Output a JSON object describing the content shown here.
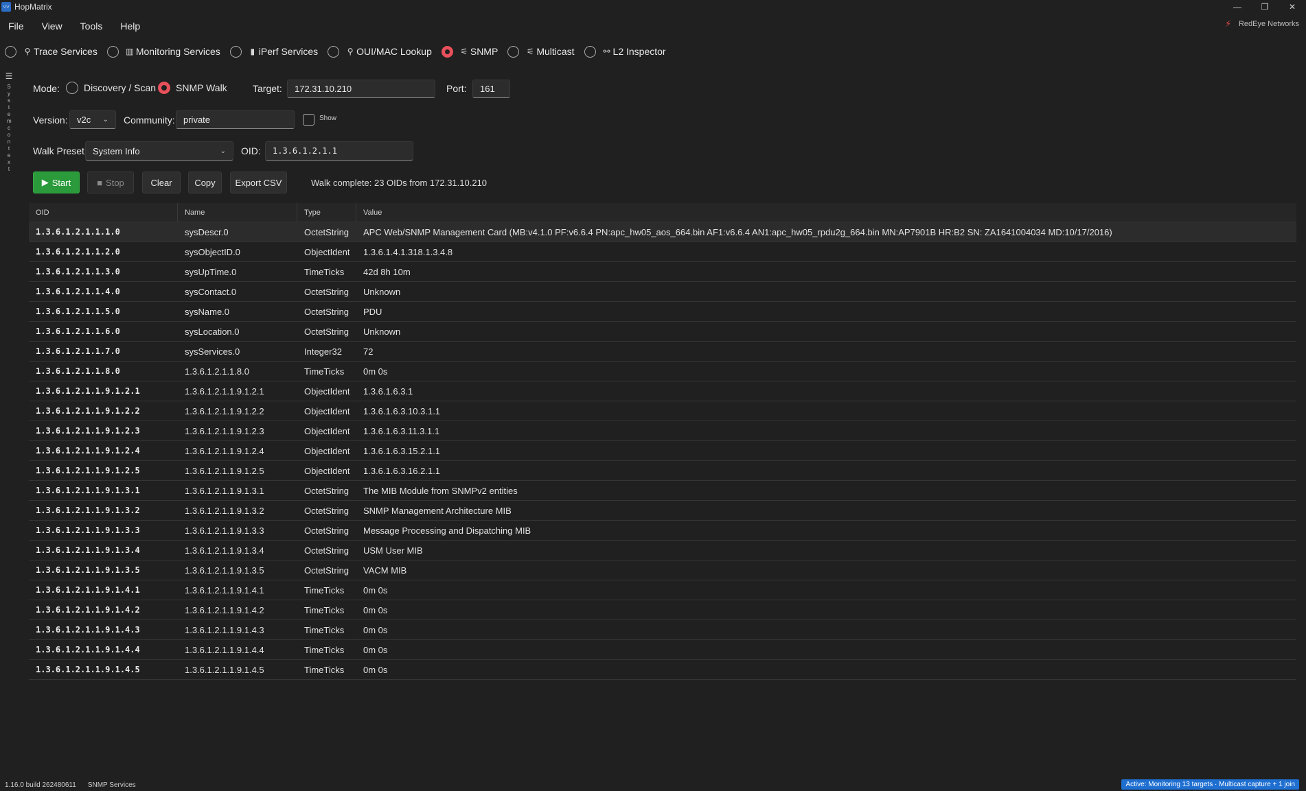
{
  "window": {
    "title": "HopMatrix",
    "app_icon": "chart-icon",
    "controls": {
      "minimize": "—",
      "restore": "❐",
      "close": "✕"
    }
  },
  "menu": [
    "File",
    "View",
    "Tools",
    "Help"
  ],
  "brand": {
    "name": "RedEye Networks",
    "icon": "redeye-icon"
  },
  "service_tabs": [
    {
      "label": "Trace Services",
      "icon": "search-icon",
      "glyph": "⚲",
      "selected": false
    },
    {
      "label": "Monitoring Services",
      "icon": "chart-icon",
      "glyph": "▥",
      "selected": false
    },
    {
      "label": "iPerf Services",
      "icon": "bar-icon",
      "glyph": "▮",
      "selected": false
    },
    {
      "label": "OUI/MAC Lookup",
      "icon": "magnifier-icon",
      "glyph": "⚲",
      "selected": false
    },
    {
      "label": "SNMP",
      "icon": "satellite-icon",
      "glyph": "⚟",
      "selected": true
    },
    {
      "label": "Multicast",
      "icon": "satellite-icon",
      "glyph": "⚟",
      "selected": false
    },
    {
      "label": "L2 Inspector",
      "icon": "link-icon",
      "glyph": "⚯",
      "selected": false
    }
  ],
  "sidebar": {
    "menu_glyph": "☰",
    "label": "System context"
  },
  "form": {
    "mode_label": "Mode:",
    "mode_options": [
      {
        "label": "Discovery / Scan",
        "selected": false
      },
      {
        "label": "SNMP Walk",
        "selected": true
      }
    ],
    "target_label": "Target:",
    "target_value": "172.31.10.210",
    "port_label": "Port:",
    "port_value": "161",
    "version_label": "Version:",
    "version_value": "v2c",
    "community_label": "Community:",
    "community_value": "private",
    "show_label": "Show",
    "walk_preset_label": "Walk Preset:",
    "walk_preset_value": "System Info",
    "oid_label": "OID:",
    "oid_value": "1.3.6.1.2.1.1"
  },
  "buttons": {
    "start": "Start",
    "stop": "Stop",
    "clear": "Clear",
    "copy": "Copy",
    "export": "Export CSV"
  },
  "status_message": "Walk complete: 23 OIDs from 172.31.10.210",
  "table": {
    "headers": [
      "OID",
      "Name",
      "Type",
      "Value"
    ],
    "rows": [
      [
        "1.3.6.1.2.1.1.1.0",
        "sysDescr.0",
        "OctetString",
        "APC Web/SNMP Management Card (MB:v4.1.0 PF:v6.6.4 PN:apc_hw05_aos_664.bin AF1:v6.6.4 AN1:apc_hw05_rpdu2g_664.bin MN:AP7901B HR:B2 SN: ZA1641004034 MD:10/17/2016)"
      ],
      [
        "1.3.6.1.2.1.1.2.0",
        "sysObjectID.0",
        "ObjectIdent",
        "1.3.6.1.4.1.318.1.3.4.8"
      ],
      [
        "1.3.6.1.2.1.1.3.0",
        "sysUpTime.0",
        "TimeTicks",
        "42d 8h 10m"
      ],
      [
        "1.3.6.1.2.1.1.4.0",
        "sysContact.0",
        "OctetString",
        "Unknown"
      ],
      [
        "1.3.6.1.2.1.1.5.0",
        "sysName.0",
        "OctetString",
        "PDU"
      ],
      [
        "1.3.6.1.2.1.1.6.0",
        "sysLocation.0",
        "OctetString",
        "Unknown"
      ],
      [
        "1.3.6.1.2.1.1.7.0",
        "sysServices.0",
        "Integer32",
        "72"
      ],
      [
        "1.3.6.1.2.1.1.8.0",
        "1.3.6.1.2.1.1.8.0",
        "TimeTicks",
        "0m 0s"
      ],
      [
        "1.3.6.1.2.1.1.9.1.2.1",
        "1.3.6.1.2.1.1.9.1.2.1",
        "ObjectIdent",
        "1.3.6.1.6.3.1"
      ],
      [
        "1.3.6.1.2.1.1.9.1.2.2",
        "1.3.6.1.2.1.1.9.1.2.2",
        "ObjectIdent",
        "1.3.6.1.6.3.10.3.1.1"
      ],
      [
        "1.3.6.1.2.1.1.9.1.2.3",
        "1.3.6.1.2.1.1.9.1.2.3",
        "ObjectIdent",
        "1.3.6.1.6.3.11.3.1.1"
      ],
      [
        "1.3.6.1.2.1.1.9.1.2.4",
        "1.3.6.1.2.1.1.9.1.2.4",
        "ObjectIdent",
        "1.3.6.1.6.3.15.2.1.1"
      ],
      [
        "1.3.6.1.2.1.1.9.1.2.5",
        "1.3.6.1.2.1.1.9.1.2.5",
        "ObjectIdent",
        "1.3.6.1.6.3.16.2.1.1"
      ],
      [
        "1.3.6.1.2.1.1.9.1.3.1",
        "1.3.6.1.2.1.1.9.1.3.1",
        "OctetString",
        "The MIB Module from SNMPv2 entities"
      ],
      [
        "1.3.6.1.2.1.1.9.1.3.2",
        "1.3.6.1.2.1.1.9.1.3.2",
        "OctetString",
        "SNMP Management Architecture MIB"
      ],
      [
        "1.3.6.1.2.1.1.9.1.3.3",
        "1.3.6.1.2.1.1.9.1.3.3",
        "OctetString",
        "Message Processing and Dispatching MIB"
      ],
      [
        "1.3.6.1.2.1.1.9.1.3.4",
        "1.3.6.1.2.1.1.9.1.3.4",
        "OctetString",
        "USM User MIB"
      ],
      [
        "1.3.6.1.2.1.1.9.1.3.5",
        "1.3.6.1.2.1.1.9.1.3.5",
        "OctetString",
        "VACM MIB"
      ],
      [
        "1.3.6.1.2.1.1.9.1.4.1",
        "1.3.6.1.2.1.1.9.1.4.1",
        "TimeTicks",
        "0m 0s"
      ],
      [
        "1.3.6.1.2.1.1.9.1.4.2",
        "1.3.6.1.2.1.1.9.1.4.2",
        "TimeTicks",
        "0m 0s"
      ],
      [
        "1.3.6.1.2.1.1.9.1.4.3",
        "1.3.6.1.2.1.1.9.1.4.3",
        "TimeTicks",
        "0m 0s"
      ],
      [
        "1.3.6.1.2.1.1.9.1.4.4",
        "1.3.6.1.2.1.1.9.1.4.4",
        "TimeTicks",
        "0m 0s"
      ],
      [
        "1.3.6.1.2.1.1.9.1.4.5",
        "1.3.6.1.2.1.1.9.1.4.5",
        "TimeTicks",
        "0m 0s"
      ]
    ]
  },
  "statusbar": {
    "version": "1.16.0 build 262480611",
    "page": "SNMP Services",
    "active": "Active: Monitoring 13 targets · Multicast capture + 1 join"
  },
  "colors": {
    "background": "#202020",
    "accent_radio": "#e8505b",
    "start_button": "#2a9a3a",
    "status_active": "#1f6fd1"
  }
}
